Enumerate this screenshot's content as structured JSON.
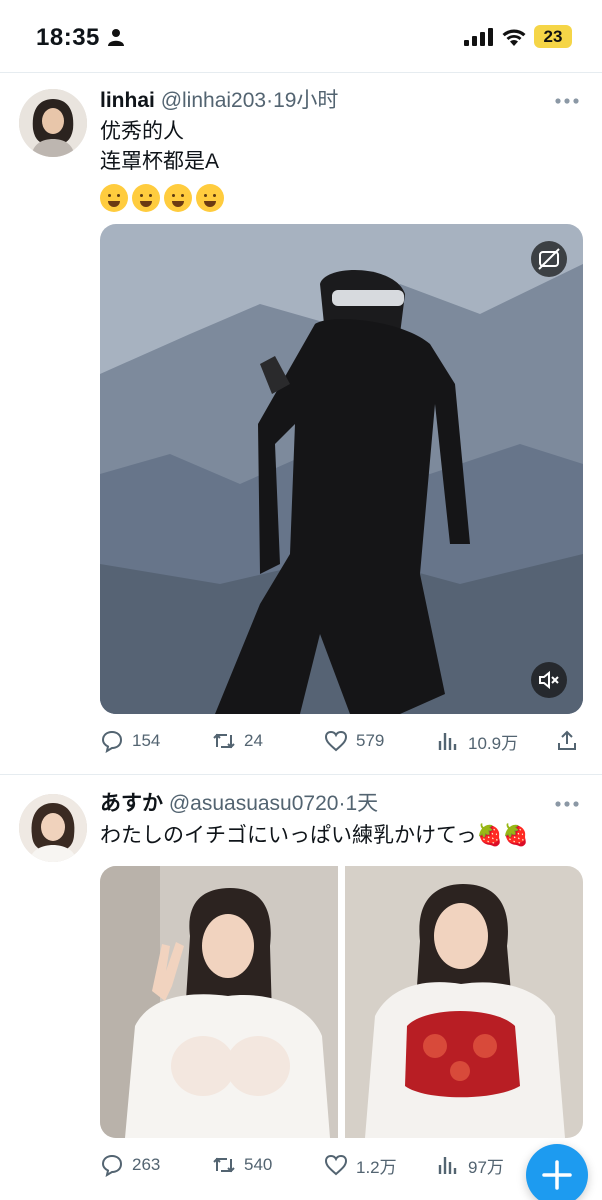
{
  "status_bar": {
    "time": "18:35",
    "battery": "23",
    "icons": [
      "person-icon",
      "signal-icon",
      "wifi-icon",
      "battery-icon"
    ]
  },
  "tweets": [
    {
      "name": "linhai",
      "handle": "@linhai203",
      "separator": "·",
      "time": "19小时",
      "text": "优秀的人\n连罩杯都是A",
      "emojis": [
        "emoji-face-holding-back-tears",
        "emoji-rolling-laughing",
        "emoji-tears-of-joy",
        "emoji-grinning-sweat"
      ],
      "actions": {
        "replies": "154",
        "retweets": "24",
        "likes": "579",
        "views": "10.9万"
      }
    },
    {
      "name": "あすか",
      "handle": "@asuasuasu0720",
      "separator": "·",
      "time": "1天",
      "text": "わたしのイチゴにいっぱい練乳かけてっ🍓🍓",
      "actions": {
        "replies": "263",
        "retweets": "540",
        "likes": "1.2万",
        "views": "97万"
      }
    }
  ],
  "colors": {
    "accent": "#1d9bf0",
    "muted_text": "#536471",
    "battery": "#f5d547"
  }
}
